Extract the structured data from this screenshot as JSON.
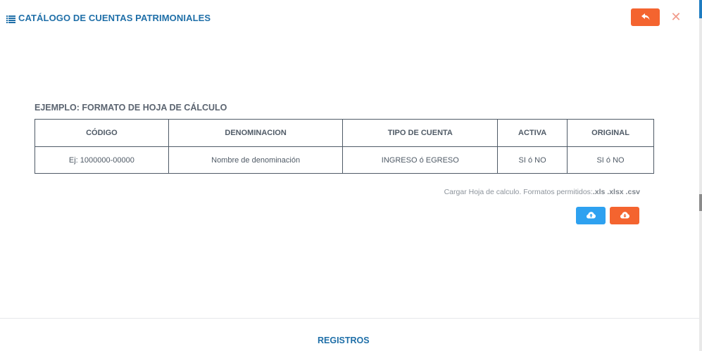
{
  "header": {
    "title": "CATÁLOGO DE CUENTAS PATRIMONIALES",
    "icon": "list-icon",
    "back_icon": "reply-icon",
    "close_label": "✕",
    "colors": {
      "title": "#1f6fa8",
      "back_button": "#f4642f",
      "close": "#f19a8a"
    }
  },
  "example": {
    "title": "EJEMPLO: FORMATO DE HOJA DE CÁLCULO",
    "columns": [
      "CÓDIGO",
      "DENOMINACION",
      "TIPO DE CUENTA",
      "ACTIVA",
      "ORIGINAL"
    ],
    "row": [
      "Ej: 1000000-00000",
      "Nombre de denominación",
      "INGRESO ó EGRESO",
      "SI ó NO",
      "SI ó NO"
    ]
  },
  "upload": {
    "label": "Cargar Hoja de calculo. Formatos permitidos:",
    "formats": ".xls .xlsx .csv",
    "upload_icon": "cloud-upload-icon",
    "download_icon": "cloud-download-icon",
    "colors": {
      "upload_button": "#2ea1f0",
      "download_button": "#f4642f"
    }
  },
  "footer": {
    "registros_label": "REGISTROS"
  }
}
